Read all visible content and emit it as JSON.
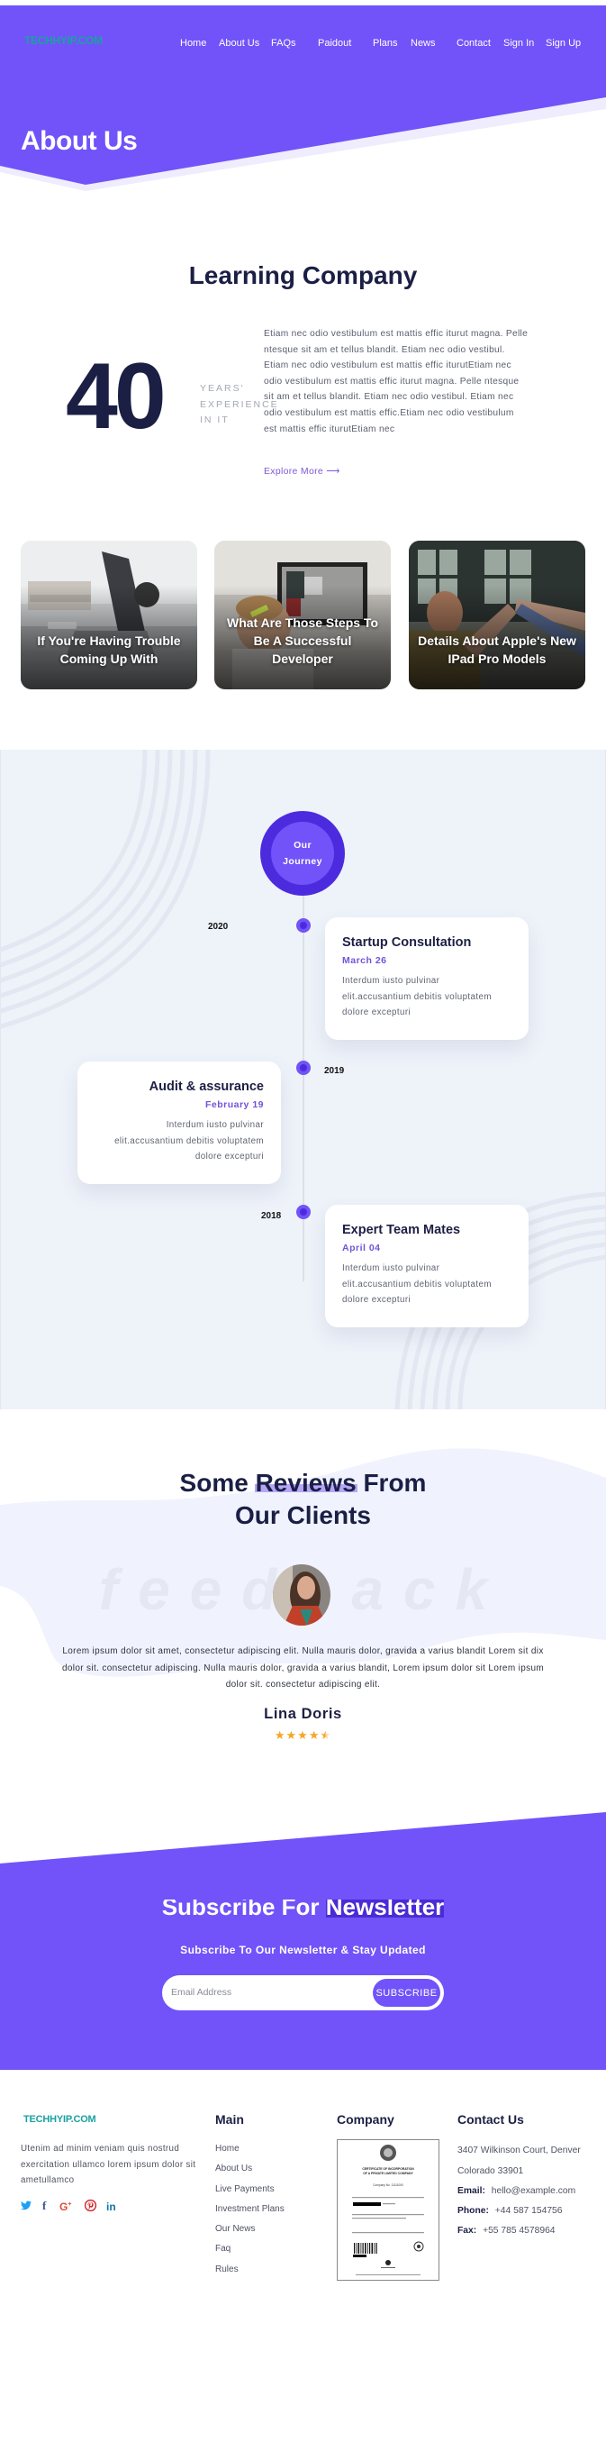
{
  "colors": {
    "primary": "#7153f9",
    "primary_dark": "#4c2bdf",
    "navy": "#1c1f44",
    "teal_logo": "#1aa1a1",
    "star": "#f5a623",
    "timeline_bg": "#eef2f9"
  },
  "header": {
    "logo": "TECHHYIP.COM",
    "nav": [
      {
        "label": "Home"
      },
      {
        "label": "About Us"
      },
      {
        "label": "FAQs"
      },
      {
        "label": "Paidout"
      },
      {
        "label": "Plans"
      },
      {
        "label": "News"
      },
      {
        "label": "Contact"
      },
      {
        "label": "Sign In"
      },
      {
        "label": "Sign Up"
      }
    ]
  },
  "hero": {
    "title": "About Us"
  },
  "about": {
    "title": "Learning Company",
    "years_number": "40",
    "years_label_lines": [
      "YEARS'",
      "EXPERIENCE",
      "IN IT"
    ],
    "body": "Etiam nec odio vestibulum est mattis effic iturut magna. Pelle ntesque sit am et tellus blandit. Etiam nec odio vestibul. Etiam nec odio vestibulum est mattis effic iturutEtiam nec odio vestibulum est mattis effic iturut magna. Pelle ntesque sit am et tellus blandit. Etiam nec odio vestibul. Etiam nec odio vestibulum est mattis effic.Etiam nec odio vestibulum est mattis effic iturutEtiam nec",
    "explore_label": "Explore More",
    "explore_icon": "arrow-right-icon"
  },
  "blog_cards": [
    {
      "title": "If You're Having Trouble Coming Up With",
      "image": "laptop-desk-photo"
    },
    {
      "title": "What Are Those Steps To Be A Successful Developer",
      "image": "developer-monitor-photo"
    },
    {
      "title": "Details About Apple's New IPad Pro Models",
      "image": "team-high-five-photo"
    }
  ],
  "journey": {
    "badge_line1": "Our",
    "badge_line2": "Journey",
    "events": [
      {
        "year": "2020",
        "title": "Startup Consultation",
        "date": "March 26",
        "text": "Interdum iusto pulvinar elit.accusantium debitis voluptatem dolore excepturi"
      },
      {
        "year": "2019",
        "title": "Audit & assurance",
        "date": "February 19",
        "text": "Interdum iusto pulvinar elit.accusantium debitis voluptatem dolore excepturi"
      },
      {
        "year": "2018",
        "title": "Expert Team Mates",
        "date": "April 04",
        "text": "Interdum iusto pulvinar elit.accusantium debitis voluptatem dolore excepturi"
      }
    ]
  },
  "reviews": {
    "title_pre": "Some",
    "title_highlight": "Reviews",
    "title_post": "From",
    "title_line2": "Our Clients",
    "watermark": "feedback",
    "quote": "Lorem ipsum dolor sit amet, consectetur adipiscing elit. Nulla mauris dolor, gravida a varius blandit Lorem sit dix dolor sit. consectetur adipiscing. Nulla mauris dolor, gravida a varius blandit, Lorem ipsum dolor sit Lorem ipsum dolor sit. consectetur adipiscing elit.",
    "name": "Lina Doris",
    "rating": 4.5,
    "rating_max": 5,
    "stars_text": "★★★★⯪"
  },
  "newsletter": {
    "title_pre": "Subscribe For",
    "title_highlight": "Newsletter",
    "subtitle": "Subscribe To Our Newsletter & Stay Updated",
    "email_placeholder": "Email Address",
    "button_label": "SUBSCRIBE"
  },
  "footer": {
    "logo": "TECHHYIP.COM",
    "about_text": "Utenim ad minim veniam quis nostrud exercitation ullamco lorem ipsum dolor sit ametullamco",
    "social": [
      {
        "name": "twitter-icon",
        "glyph": "🐦",
        "color": "#1da1f2"
      },
      {
        "name": "facebook-icon",
        "glyph": "f",
        "color": "#3b5998"
      },
      {
        "name": "google-plus-icon",
        "glyph": "G+",
        "color": "#dd4b39"
      },
      {
        "name": "pinterest-icon",
        "glyph": "℗",
        "color": "#cb2027"
      },
      {
        "name": "linkedin-icon",
        "glyph": "in",
        "color": "#0e76a8"
      }
    ],
    "main_heading": "Main",
    "main_links": [
      "Home",
      "About Us",
      "Live Payments",
      "Investment Plans",
      "Our News",
      "Faq",
      "Rules"
    ],
    "company_heading": "Company",
    "certificate": {
      "title_line1": "CERTIFICATE OF INCORPORATION",
      "title_line2": "OF A PRIVATE LIMITED COMPANY",
      "company_no": "Company No. 11111000"
    },
    "contact_heading": "Contact Us",
    "address_line1": "3407 Wilkinson Court, Denver",
    "address_line2": "Colorado 33901",
    "email_label": "Email:",
    "email": "hello@example.com",
    "phone_label": "Phone:",
    "phone": "+44 587 154756",
    "fax_label": "Fax:",
    "fax": "+55 785 4578964"
  }
}
